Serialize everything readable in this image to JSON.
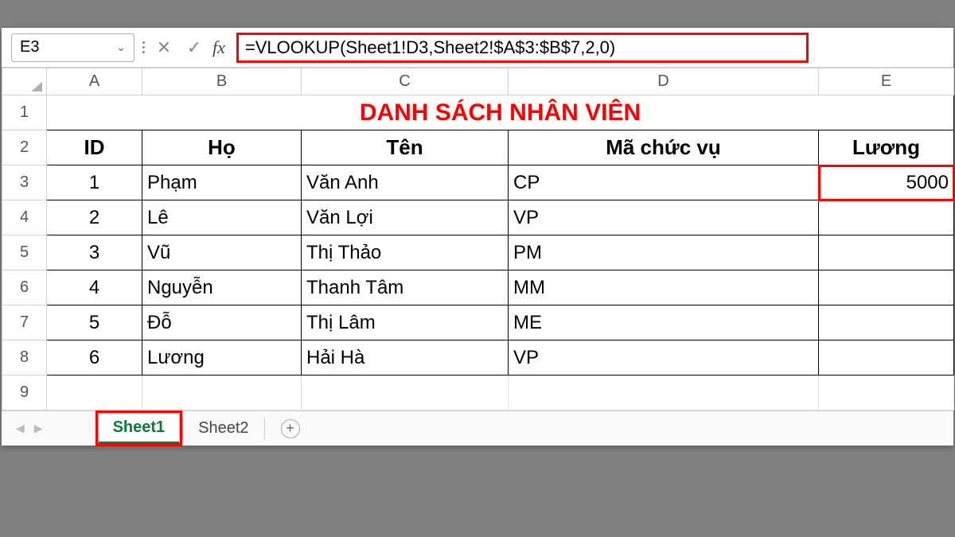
{
  "name_box": "E3",
  "formula": "=VLOOKUP(Sheet1!D3,Sheet2!$A$3:$B$7,2,0)",
  "columns": [
    "A",
    "B",
    "C",
    "D",
    "E"
  ],
  "row_numbers": [
    "1",
    "2",
    "3",
    "4",
    "5",
    "6",
    "7",
    "8",
    "9"
  ],
  "title": "DANH SÁCH NHÂN VIÊN",
  "headers": {
    "a": "ID",
    "b": "Họ",
    "c": "Tên",
    "d": "Mã chức vụ",
    "e": "Lương"
  },
  "rows": [
    {
      "id": "1",
      "ho": "Phạm",
      "ten": "Văn Anh",
      "ma": "CP",
      "luong": "5000"
    },
    {
      "id": "2",
      "ho": "Lê",
      "ten": "Văn Lợi",
      "ma": "VP",
      "luong": ""
    },
    {
      "id": "3",
      "ho": "Vũ",
      "ten": "Thị Thảo",
      "ma": "PM",
      "luong": ""
    },
    {
      "id": "4",
      "ho": "Nguyễn",
      "ten": "Thanh Tâm",
      "ma": "MM",
      "luong": ""
    },
    {
      "id": "5",
      "ho": "Đỗ",
      "ten": "Thị Lâm",
      "ma": "ME",
      "luong": ""
    },
    {
      "id": "6",
      "ho": "Lương",
      "ten": "Hải Hà",
      "ma": "VP",
      "luong": ""
    }
  ],
  "tabs": {
    "active": "Sheet1",
    "other": "Sheet2"
  },
  "icons": {
    "fx": "fx",
    "plus": "+",
    "chev": "⌄",
    "cancel": "✕",
    "accept": "✓"
  }
}
